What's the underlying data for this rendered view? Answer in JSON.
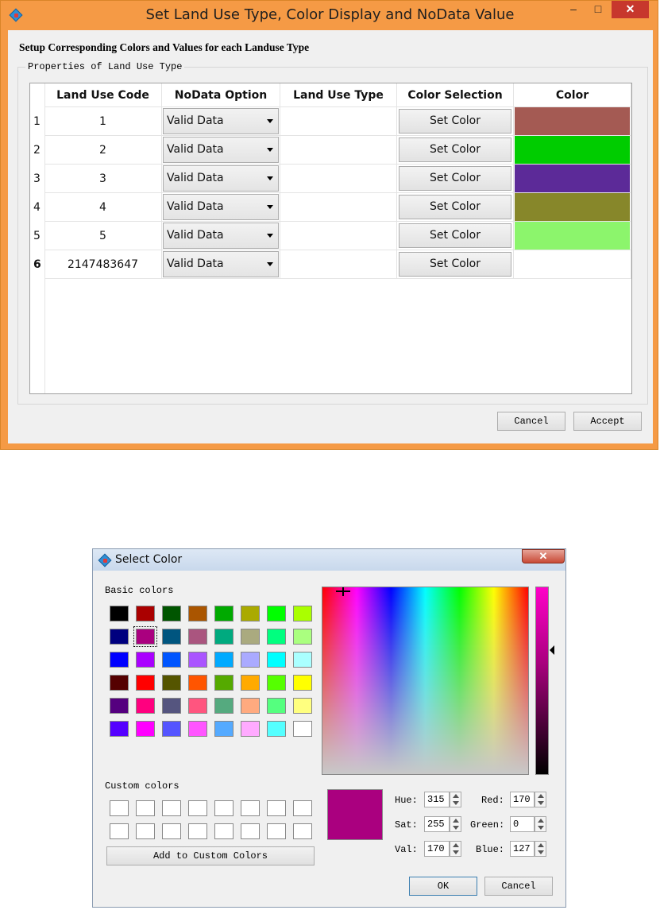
{
  "main_window": {
    "title": "Set Land Use Type, Color Display and NoData Value",
    "minimize_glyph": "–",
    "maximize_glyph": "□",
    "close_glyph": "✕",
    "heading": "Setup Corresponding Colors and Values for each Landuse Type",
    "group_title": "Properties of Land Use Type",
    "table": {
      "headers": [
        "Land Use Code",
        "NoData Option",
        "Land Use Type",
        "Color Selection",
        "Color"
      ],
      "rows": [
        {
          "num": "1",
          "code": "1",
          "option": "Valid Data",
          "type": "",
          "button": "Set Color",
          "color": "#a45a53"
        },
        {
          "num": "2",
          "code": "2",
          "option": "Valid Data",
          "type": "",
          "button": "Set Color",
          "color": "#00cc00"
        },
        {
          "num": "3",
          "code": "3",
          "option": "Valid Data",
          "type": "",
          "button": "Set Color",
          "color": "#5c2a98"
        },
        {
          "num": "4",
          "code": "4",
          "option": "Valid Data",
          "type": "",
          "button": "Set Color",
          "color": "#87872a"
        },
        {
          "num": "5",
          "code": "5",
          "option": "Valid Data",
          "type": "",
          "button": "Set Color",
          "color": "#8cf56c"
        },
        {
          "num": "6",
          "code": "2147483647",
          "option": "Valid Data",
          "type": "",
          "button": "Set Color",
          "color": "#ffffff"
        }
      ]
    },
    "cancel_label": "Cancel",
    "accept_label": "Accept"
  },
  "color_dialog": {
    "title": "Select Color",
    "close_glyph": "✕",
    "basic_colors_label": "Basic colors",
    "basic_colors": [
      "#000000",
      "#aa0000",
      "#005500",
      "#aa5500",
      "#00aa00",
      "#aaaa00",
      "#00ff00",
      "#aaff00",
      "#00007f",
      "#aa007f",
      "#00557f",
      "#aa557f",
      "#00aa7f",
      "#aaaa7f",
      "#00ff7f",
      "#aaff7f",
      "#0000ff",
      "#aa00ff",
      "#0055ff",
      "#aa55ff",
      "#00aaff",
      "#aaaaff",
      "#00ffff",
      "#aaffff",
      "#550000",
      "#ff0000",
      "#555500",
      "#ff5500",
      "#55aa00",
      "#ffaa00",
      "#55ff00",
      "#ffff00",
      "#55007f",
      "#ff007f",
      "#55557f",
      "#ff557f",
      "#55aa7f",
      "#ffaa7f",
      "#55ff7f",
      "#ffff7f",
      "#5500ff",
      "#ff00ff",
      "#5555ff",
      "#ff55ff",
      "#55aaff",
      "#ffaaff",
      "#55ffff",
      "#ffffff"
    ],
    "selected_basic_index": 9,
    "custom_colors_label": "Custom colors",
    "add_custom_label": "Add to Custom Colors",
    "current_color": "#aa007f",
    "hue_label": "Hue:",
    "hue_value": "315",
    "sat_label": "Sat:",
    "sat_value": "255",
    "val_label": "Val:",
    "val_value": "170",
    "red_label": "Red:",
    "red_value": "170",
    "green_label": "Green:",
    "green_value": "0",
    "blue_label": "Blue:",
    "blue_value": "127",
    "ok_label": "OK",
    "cancel_label": "Cancel"
  }
}
